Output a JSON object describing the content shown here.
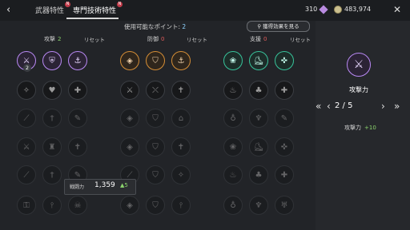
{
  "header": {
    "tabs": [
      {
        "label": "武器特性",
        "badge": "N"
      },
      {
        "label": "専門技術特性",
        "badge": "N"
      }
    ],
    "currency_gems": "310",
    "currency_gold": "483,974"
  },
  "points_label": "使用可能なポイント: ",
  "points_value": "2",
  "effect_button": "獲得効果を見る",
  "columns": [
    {
      "name": "攻撃",
      "value": "2",
      "reset": "リセット"
    },
    {
      "name": "防御",
      "value": "0",
      "reset": "リセット"
    },
    {
      "name": "支援",
      "value": "0",
      "reset": "リセット"
    }
  ],
  "level_badge": "2",
  "combat_power": {
    "label": "戦闘力",
    "value": "1,359",
    "increase": "▲5"
  },
  "detail": {
    "skill_name": "攻撃力",
    "page": "2 / 5",
    "stat_name": "攻撃力",
    "stat_value": "+10"
  },
  "colors": {
    "attack": "#b989f4",
    "defense": "#d58e36",
    "support": "#38c39b",
    "positive": "#8bd46d",
    "zero": "#e05b5b"
  }
}
